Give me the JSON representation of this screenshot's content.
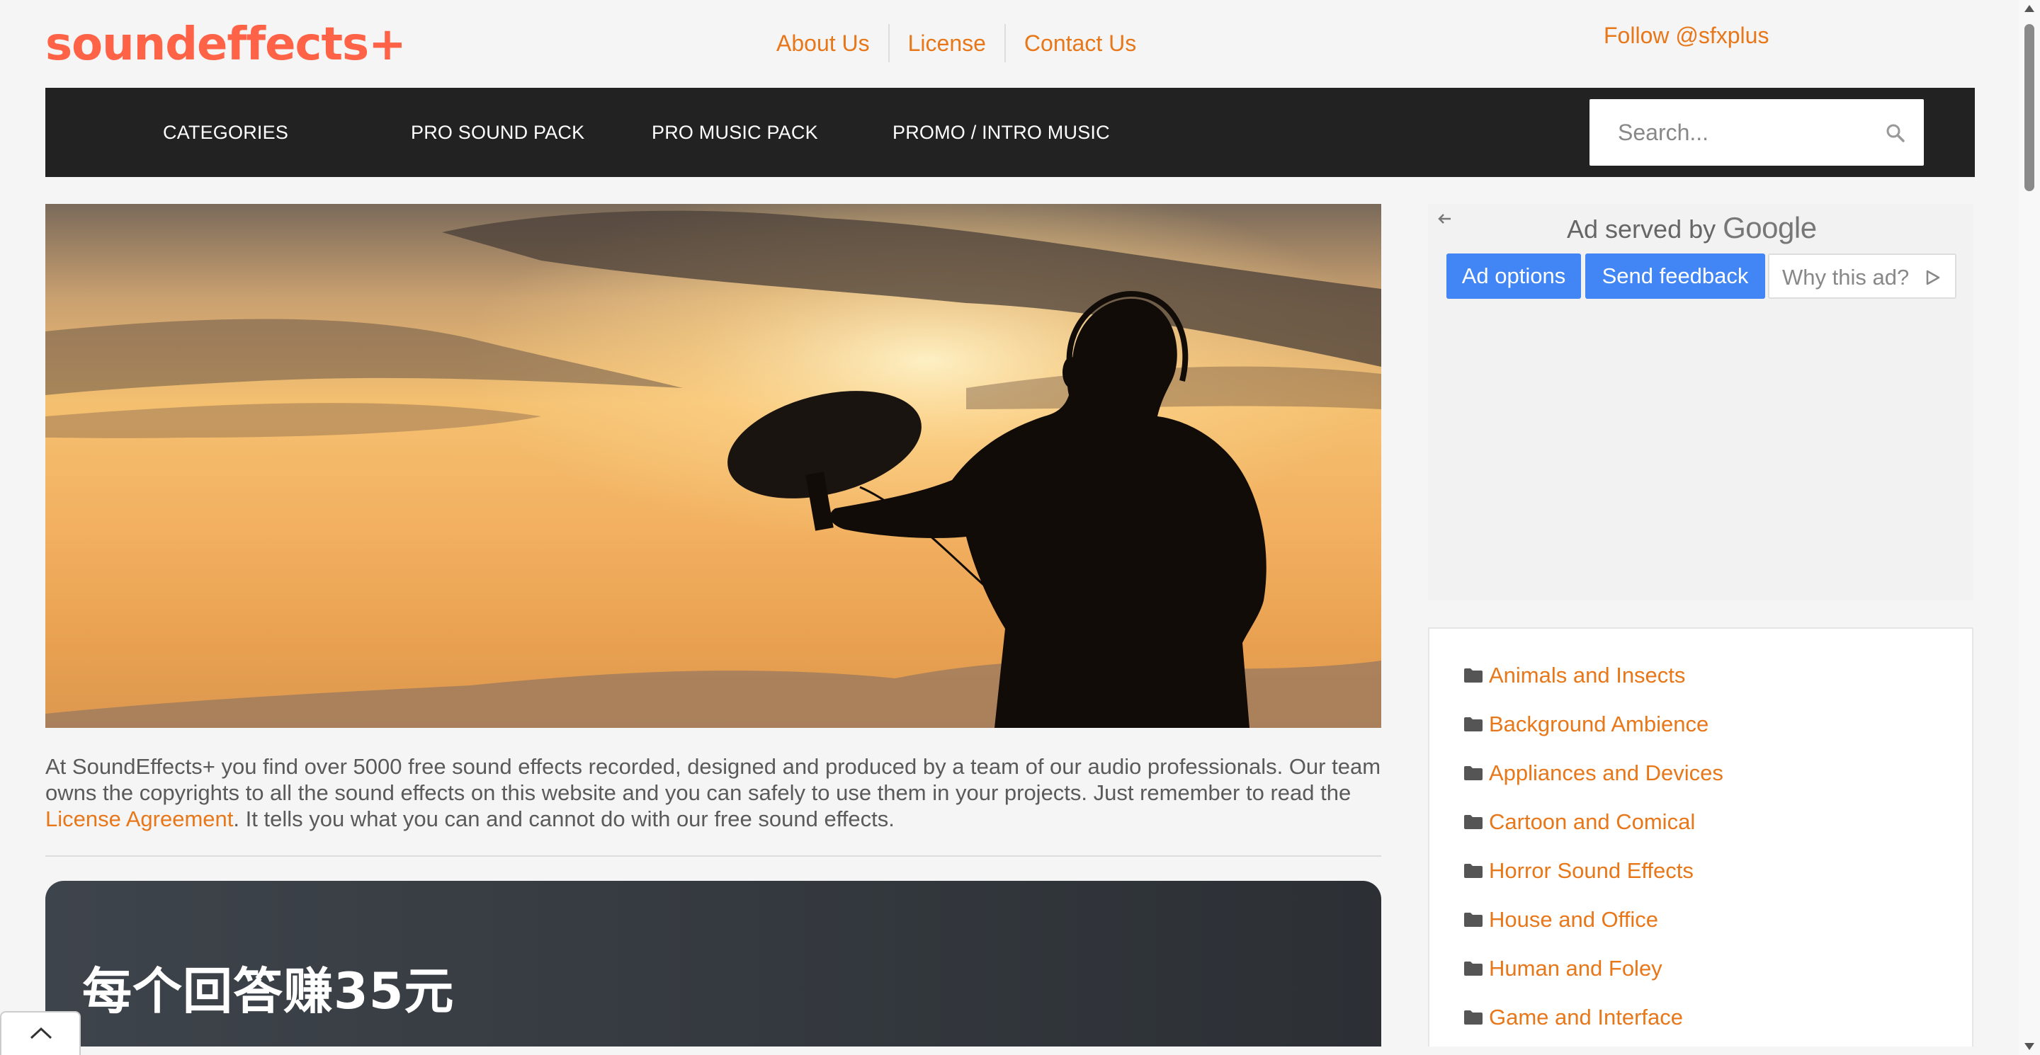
{
  "header": {
    "logo": "soundeffects+",
    "links": [
      "About Us",
      "License",
      "Contact Us"
    ],
    "follow": "Follow @sfxplus"
  },
  "nav": {
    "items": [
      "CATEGORIES",
      "PRO SOUND PACK",
      "PRO MUSIC PACK",
      "PROMO / INTRO MUSIC"
    ],
    "search_placeholder": "Search..."
  },
  "intro": {
    "text_before": "At SoundEffects+ you find over 5000 free sound effects recorded, designed and produced by a team of our audio professionals. Our team owns the copyrights to all the sound effects on this website and you can safely to use them in your projects. Just remember to read the ",
    "link": "License Agreement",
    "text_after": ". It tells you what you can and cannot do with our free sound effects."
  },
  "promo": {
    "title": "每个回答赚35元"
  },
  "ad": {
    "served_by": "Ad served by",
    "google": "Google",
    "options": "Ad options",
    "feedback": "Send feedback",
    "why": "Why this ad?"
  },
  "categories": [
    "Animals and Insects",
    "Background Ambience",
    "Appliances and Devices",
    "Cartoon and Comical",
    "Horror Sound Effects",
    "House and Office",
    "Human and Foley",
    "Game and Interface"
  ],
  "colors": {
    "accent": "#e8771a",
    "logo": "#ff6347",
    "navbar": "#222222",
    "ad_button": "#4285f4"
  }
}
